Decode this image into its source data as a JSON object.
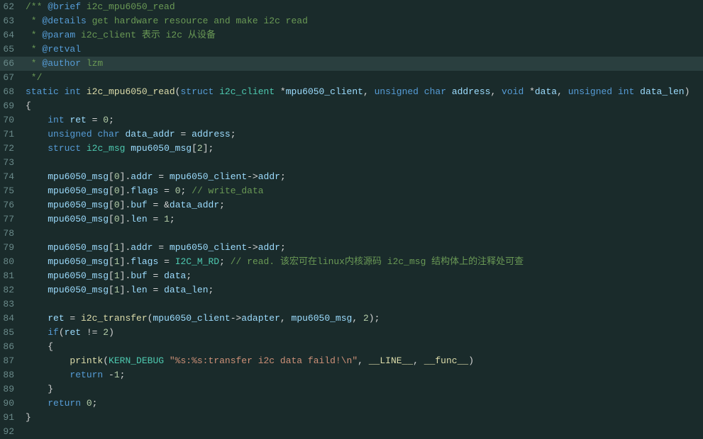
{
  "lines": [
    {
      "num": "62",
      "highlighted": false,
      "tokens": [
        {
          "t": "comment-doc",
          "v": "/** "
        },
        {
          "t": "doc-tag",
          "v": "@brief"
        },
        {
          "t": "comment-doc",
          "v": " i2c_mpu6050_read"
        }
      ]
    },
    {
      "num": "63",
      "highlighted": false,
      "tokens": [
        {
          "t": "comment-doc",
          "v": " * "
        },
        {
          "t": "doc-tag",
          "v": "@details"
        },
        {
          "t": "comment-doc",
          "v": " get hardware resource and make i2c read"
        }
      ]
    },
    {
      "num": "64",
      "highlighted": false,
      "tokens": [
        {
          "t": "comment-doc",
          "v": " * "
        },
        {
          "t": "doc-tag",
          "v": "@param"
        },
        {
          "t": "comment-doc",
          "v": " i2c_client 表示 i2c 从设备"
        }
      ]
    },
    {
      "num": "65",
      "highlighted": false,
      "tokens": [
        {
          "t": "comment-doc",
          "v": " * "
        },
        {
          "t": "doc-tag",
          "v": "@retval"
        }
      ]
    },
    {
      "num": "66",
      "highlighted": true,
      "tokens": [
        {
          "t": "comment-doc",
          "v": " * "
        },
        {
          "t": "doc-tag",
          "v": "@author"
        },
        {
          "t": "comment-doc",
          "v": " lzm"
        }
      ]
    },
    {
      "num": "67",
      "highlighted": false,
      "tokens": [
        {
          "t": "comment-doc",
          "v": " */"
        }
      ]
    },
    {
      "num": "68",
      "highlighted": false,
      "tokens": [
        {
          "t": "kw",
          "v": "static"
        },
        {
          "t": "plain",
          "v": " "
        },
        {
          "t": "kw",
          "v": "int"
        },
        {
          "t": "plain",
          "v": " "
        },
        {
          "t": "fn",
          "v": "i2c_mpu6050_read"
        },
        {
          "t": "punct",
          "v": "("
        },
        {
          "t": "kw",
          "v": "struct"
        },
        {
          "t": "plain",
          "v": " "
        },
        {
          "t": "type",
          "v": "i2c_client"
        },
        {
          "t": "plain",
          "v": " *"
        },
        {
          "t": "var",
          "v": "mpu6050_client"
        },
        {
          "t": "punct",
          "v": ", "
        },
        {
          "t": "kw",
          "v": "unsigned"
        },
        {
          "t": "plain",
          "v": " "
        },
        {
          "t": "kw",
          "v": "char"
        },
        {
          "t": "plain",
          "v": " "
        },
        {
          "t": "var",
          "v": "address"
        },
        {
          "t": "punct",
          "v": ", "
        },
        {
          "t": "kw",
          "v": "void"
        },
        {
          "t": "plain",
          "v": " *"
        },
        {
          "t": "var",
          "v": "data"
        },
        {
          "t": "punct",
          "v": ", "
        },
        {
          "t": "kw",
          "v": "unsigned"
        },
        {
          "t": "plain",
          "v": " "
        },
        {
          "t": "kw",
          "v": "int"
        },
        {
          "t": "plain",
          "v": " "
        },
        {
          "t": "var",
          "v": "data_len"
        },
        {
          "t": "punct",
          "v": ")"
        }
      ]
    },
    {
      "num": "69",
      "highlighted": false,
      "tokens": [
        {
          "t": "punct",
          "v": "{"
        }
      ]
    },
    {
      "num": "70",
      "highlighted": false,
      "tokens": [
        {
          "t": "plain",
          "v": "    "
        },
        {
          "t": "kw",
          "v": "int"
        },
        {
          "t": "plain",
          "v": " "
        },
        {
          "t": "var",
          "v": "ret"
        },
        {
          "t": "plain",
          "v": " = "
        },
        {
          "t": "num",
          "v": "0"
        },
        {
          "t": "punct",
          "v": ";"
        }
      ]
    },
    {
      "num": "71",
      "highlighted": false,
      "tokens": [
        {
          "t": "plain",
          "v": "    "
        },
        {
          "t": "kw",
          "v": "unsigned"
        },
        {
          "t": "plain",
          "v": " "
        },
        {
          "t": "kw",
          "v": "char"
        },
        {
          "t": "plain",
          "v": " "
        },
        {
          "t": "var",
          "v": "data_addr"
        },
        {
          "t": "plain",
          "v": " = "
        },
        {
          "t": "var",
          "v": "address"
        },
        {
          "t": "punct",
          "v": ";"
        }
      ]
    },
    {
      "num": "72",
      "highlighted": false,
      "tokens": [
        {
          "t": "plain",
          "v": "    "
        },
        {
          "t": "kw",
          "v": "struct"
        },
        {
          "t": "plain",
          "v": " "
        },
        {
          "t": "type",
          "v": "i2c_msg"
        },
        {
          "t": "plain",
          "v": " "
        },
        {
          "t": "var",
          "v": "mpu6050_msg"
        },
        {
          "t": "punct",
          "v": "["
        },
        {
          "t": "num",
          "v": "2"
        },
        {
          "t": "punct",
          "v": "];"
        }
      ]
    },
    {
      "num": "73",
      "highlighted": false,
      "tokens": []
    },
    {
      "num": "74",
      "highlighted": false,
      "tokens": [
        {
          "t": "plain",
          "v": "    "
        },
        {
          "t": "var",
          "v": "mpu6050_msg"
        },
        {
          "t": "punct",
          "v": "["
        },
        {
          "t": "num",
          "v": "0"
        },
        {
          "t": "punct",
          "v": "]."
        },
        {
          "t": "var",
          "v": "addr"
        },
        {
          "t": "plain",
          "v": " = "
        },
        {
          "t": "var",
          "v": "mpu6050_client"
        },
        {
          "t": "arrow",
          "v": "->"
        },
        {
          "t": "var",
          "v": "addr"
        },
        {
          "t": "punct",
          "v": ";"
        }
      ]
    },
    {
      "num": "75",
      "highlighted": false,
      "tokens": [
        {
          "t": "plain",
          "v": "    "
        },
        {
          "t": "var",
          "v": "mpu6050_msg"
        },
        {
          "t": "punct",
          "v": "["
        },
        {
          "t": "num",
          "v": "0"
        },
        {
          "t": "punct",
          "v": "]."
        },
        {
          "t": "var",
          "v": "flags"
        },
        {
          "t": "plain",
          "v": " = "
        },
        {
          "t": "num",
          "v": "0"
        },
        {
          "t": "punct",
          "v": ";"
        },
        {
          "t": "plain",
          "v": " "
        },
        {
          "t": "comment",
          "v": "// write_data"
        }
      ]
    },
    {
      "num": "76",
      "highlighted": false,
      "tokens": [
        {
          "t": "plain",
          "v": "    "
        },
        {
          "t": "var",
          "v": "mpu6050_msg"
        },
        {
          "t": "punct",
          "v": "["
        },
        {
          "t": "num",
          "v": "0"
        },
        {
          "t": "punct",
          "v": "]."
        },
        {
          "t": "var",
          "v": "buf"
        },
        {
          "t": "plain",
          "v": " = &"
        },
        {
          "t": "var",
          "v": "data_addr"
        },
        {
          "t": "punct",
          "v": ";"
        }
      ]
    },
    {
      "num": "77",
      "highlighted": false,
      "tokens": [
        {
          "t": "plain",
          "v": "    "
        },
        {
          "t": "var",
          "v": "mpu6050_msg"
        },
        {
          "t": "punct",
          "v": "["
        },
        {
          "t": "num",
          "v": "0"
        },
        {
          "t": "punct",
          "v": "]."
        },
        {
          "t": "var",
          "v": "len"
        },
        {
          "t": "plain",
          "v": " = "
        },
        {
          "t": "num",
          "v": "1"
        },
        {
          "t": "punct",
          "v": ";"
        }
      ]
    },
    {
      "num": "78",
      "highlighted": false,
      "tokens": []
    },
    {
      "num": "79",
      "highlighted": false,
      "tokens": [
        {
          "t": "plain",
          "v": "    "
        },
        {
          "t": "var",
          "v": "mpu6050_msg"
        },
        {
          "t": "punct",
          "v": "["
        },
        {
          "t": "num",
          "v": "1"
        },
        {
          "t": "punct",
          "v": "]."
        },
        {
          "t": "var",
          "v": "addr"
        },
        {
          "t": "plain",
          "v": " = "
        },
        {
          "t": "var",
          "v": "mpu6050_client"
        },
        {
          "t": "arrow",
          "v": "->"
        },
        {
          "t": "var",
          "v": "addr"
        },
        {
          "t": "punct",
          "v": ";"
        }
      ]
    },
    {
      "num": "80",
      "highlighted": false,
      "tokens": [
        {
          "t": "plain",
          "v": "    "
        },
        {
          "t": "var",
          "v": "mpu6050_msg"
        },
        {
          "t": "punct",
          "v": "["
        },
        {
          "t": "num",
          "v": "1"
        },
        {
          "t": "punct",
          "v": "]."
        },
        {
          "t": "var",
          "v": "flags"
        },
        {
          "t": "plain",
          "v": " = "
        },
        {
          "t": "cn",
          "v": "I2C_M_RD"
        },
        {
          "t": "punct",
          "v": ";"
        },
        {
          "t": "plain",
          "v": " "
        },
        {
          "t": "comment",
          "v": "// read. 该宏可在linux内核源码 i2c_msg 结构体上的注释处可查"
        }
      ]
    },
    {
      "num": "81",
      "highlighted": false,
      "tokens": [
        {
          "t": "plain",
          "v": "    "
        },
        {
          "t": "var",
          "v": "mpu6050_msg"
        },
        {
          "t": "punct",
          "v": "["
        },
        {
          "t": "num",
          "v": "1"
        },
        {
          "t": "punct",
          "v": "]."
        },
        {
          "t": "var",
          "v": "buf"
        },
        {
          "t": "plain",
          "v": " = "
        },
        {
          "t": "var",
          "v": "data"
        },
        {
          "t": "punct",
          "v": ";"
        }
      ]
    },
    {
      "num": "82",
      "highlighted": false,
      "tokens": [
        {
          "t": "plain",
          "v": "    "
        },
        {
          "t": "var",
          "v": "mpu6050_msg"
        },
        {
          "t": "punct",
          "v": "["
        },
        {
          "t": "num",
          "v": "1"
        },
        {
          "t": "punct",
          "v": "]."
        },
        {
          "t": "var",
          "v": "len"
        },
        {
          "t": "plain",
          "v": " = "
        },
        {
          "t": "var",
          "v": "data_len"
        },
        {
          "t": "punct",
          "v": ";"
        }
      ]
    },
    {
      "num": "83",
      "highlighted": false,
      "tokens": []
    },
    {
      "num": "84",
      "highlighted": false,
      "tokens": [
        {
          "t": "plain",
          "v": "    "
        },
        {
          "t": "var",
          "v": "ret"
        },
        {
          "t": "plain",
          "v": " = "
        },
        {
          "t": "fn",
          "v": "i2c_transfer"
        },
        {
          "t": "punct",
          "v": "("
        },
        {
          "t": "var",
          "v": "mpu6050_client"
        },
        {
          "t": "arrow",
          "v": "->"
        },
        {
          "t": "var",
          "v": "adapter"
        },
        {
          "t": "punct",
          "v": ", "
        },
        {
          "t": "var",
          "v": "mpu6050_msg"
        },
        {
          "t": "punct",
          "v": ", "
        },
        {
          "t": "num",
          "v": "2"
        },
        {
          "t": "punct",
          "v": ");"
        }
      ]
    },
    {
      "num": "85",
      "highlighted": false,
      "tokens": [
        {
          "t": "plain",
          "v": "    "
        },
        {
          "t": "kw",
          "v": "if"
        },
        {
          "t": "punct",
          "v": "("
        },
        {
          "t": "var",
          "v": "ret"
        },
        {
          "t": "plain",
          "v": " != "
        },
        {
          "t": "num",
          "v": "2"
        },
        {
          "t": "punct",
          "v": ")"
        }
      ]
    },
    {
      "num": "86",
      "highlighted": false,
      "tokens": [
        {
          "t": "plain",
          "v": "    "
        },
        {
          "t": "punct",
          "v": "{"
        }
      ]
    },
    {
      "num": "87",
      "highlighted": false,
      "tokens": [
        {
          "t": "plain",
          "v": "        "
        },
        {
          "t": "fn",
          "v": "printk"
        },
        {
          "t": "punct",
          "v": "("
        },
        {
          "t": "cn",
          "v": "KERN_DEBUG"
        },
        {
          "t": "plain",
          "v": " "
        },
        {
          "t": "str",
          "v": "\"%s:%s:transfer i2c data faild!\\n\""
        },
        {
          "t": "punct",
          "v": ", "
        },
        {
          "t": "macro",
          "v": "__LINE__"
        },
        {
          "t": "punct",
          "v": ", "
        },
        {
          "t": "macro",
          "v": "__func__"
        },
        {
          "t": "punct",
          "v": ")"
        }
      ]
    },
    {
      "num": "88",
      "highlighted": false,
      "tokens": [
        {
          "t": "plain",
          "v": "        "
        },
        {
          "t": "kw",
          "v": "return"
        },
        {
          "t": "plain",
          "v": " "
        },
        {
          "t": "plain",
          "v": "-"
        },
        {
          "t": "num",
          "v": "1"
        },
        {
          "t": "punct",
          "v": ";"
        }
      ]
    },
    {
      "num": "89",
      "highlighted": false,
      "tokens": [
        {
          "t": "plain",
          "v": "    "
        },
        {
          "t": "punct",
          "v": "}"
        }
      ]
    },
    {
      "num": "90",
      "highlighted": false,
      "tokens": [
        {
          "t": "plain",
          "v": "    "
        },
        {
          "t": "kw",
          "v": "return"
        },
        {
          "t": "plain",
          "v": " "
        },
        {
          "t": "num",
          "v": "0"
        },
        {
          "t": "punct",
          "v": ";"
        }
      ]
    },
    {
      "num": "91",
      "highlighted": false,
      "tokens": [
        {
          "t": "punct",
          "v": "}"
        }
      ]
    },
    {
      "num": "92",
      "highlighted": false,
      "tokens": []
    }
  ]
}
